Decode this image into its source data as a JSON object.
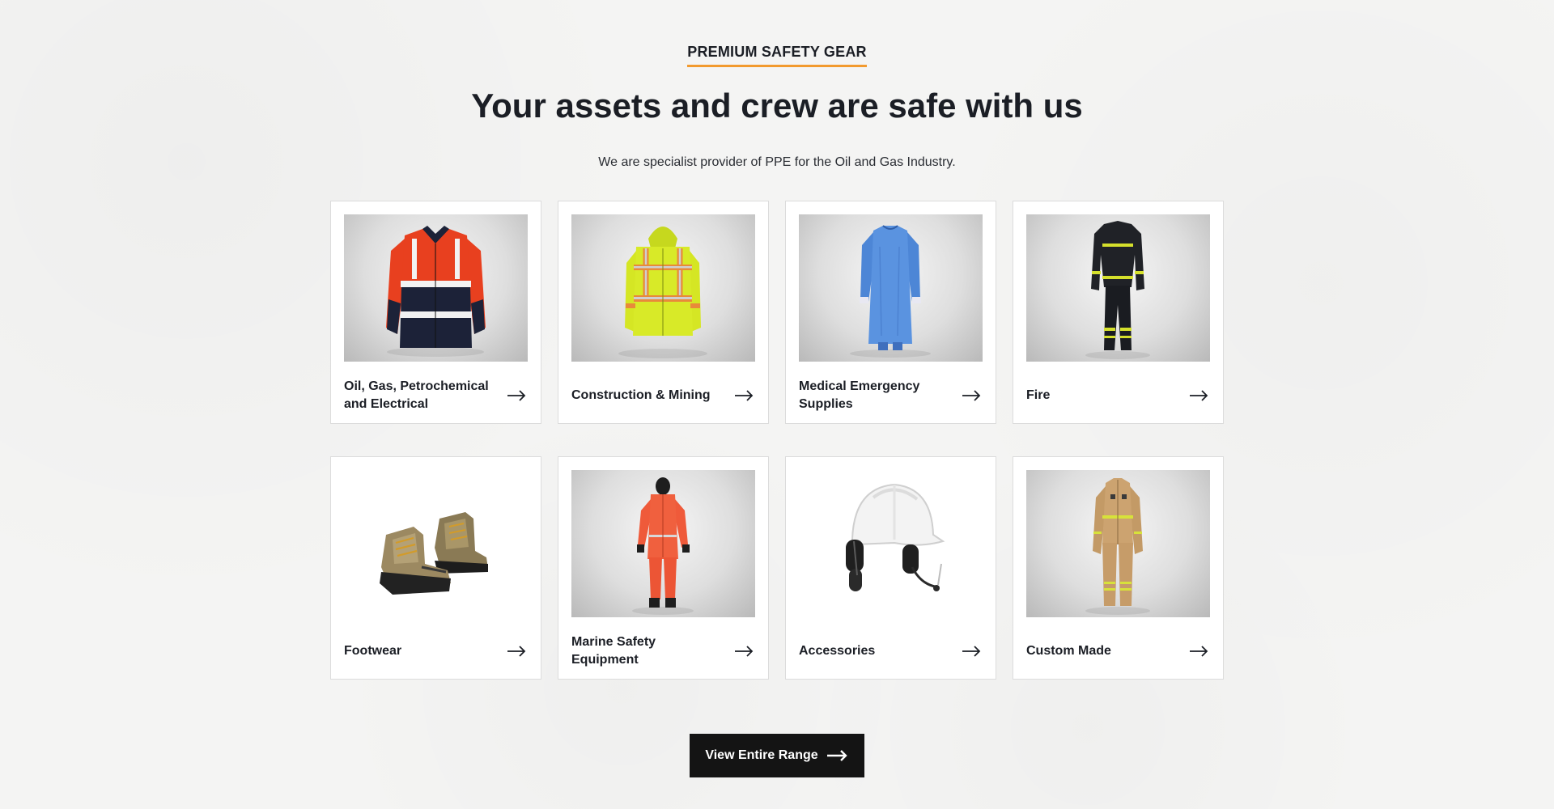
{
  "section": {
    "eyebrow": "PREMIUM SAFETY GEAR",
    "headline": "Your assets and crew are safe with us",
    "subtext": "We are specialist provider of PPE for the Oil and Gas Industry."
  },
  "categories": [
    {
      "label": "Oil, Gas, Petrochemical and Electrical",
      "icon": "arrow-right-icon"
    },
    {
      "label": "Construction & Mining",
      "icon": "arrow-right-icon"
    },
    {
      "label": "Medical Emergency Supplies",
      "icon": "arrow-right-icon"
    },
    {
      "label": "Fire",
      "icon": "arrow-right-icon"
    },
    {
      "label": "Footwear",
      "icon": "arrow-right-icon"
    },
    {
      "label": "Marine Safety Equipment",
      "icon": "arrow-right-icon"
    },
    {
      "label": "Accessories",
      "icon": "arrow-right-icon"
    },
    {
      "label": "Custom Made",
      "icon": "arrow-right-icon"
    }
  ],
  "cta": {
    "label": "View Entire Range",
    "icon": "arrow-right-icon"
  },
  "colors": {
    "accent": "#f29a2e",
    "text": "#1b1e25",
    "button_bg": "#141414",
    "card_border": "#dcdcdc"
  }
}
